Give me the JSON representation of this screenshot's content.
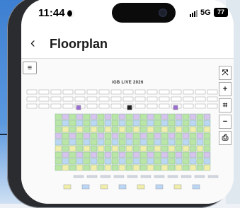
{
  "status_bar": {
    "time": "11:44",
    "network": "5G",
    "battery": "77"
  },
  "nav": {
    "back_icon": "‹",
    "title": "Floorplan"
  },
  "floorplan": {
    "event_name": "iGB LIVE 2026",
    "controls": [
      {
        "name": "expand-button",
        "glyph": "⤧"
      },
      {
        "name": "zoom-in-button",
        "glyph": "+"
      },
      {
        "name": "crop-button",
        "glyph": "⌗"
      },
      {
        "name": "zoom-out-button",
        "glyph": "−"
      },
      {
        "name": "export-button",
        "glyph": "⎙"
      }
    ],
    "menu_icon": "≡"
  },
  "colors": {
    "accent": "#3d7fd1",
    "booth_green": "#b9e6a6",
    "booth_purple": "#d6c4ee",
    "booth_blue": "#bcd7f4",
    "booth_yellow": "#f0eeaa"
  }
}
